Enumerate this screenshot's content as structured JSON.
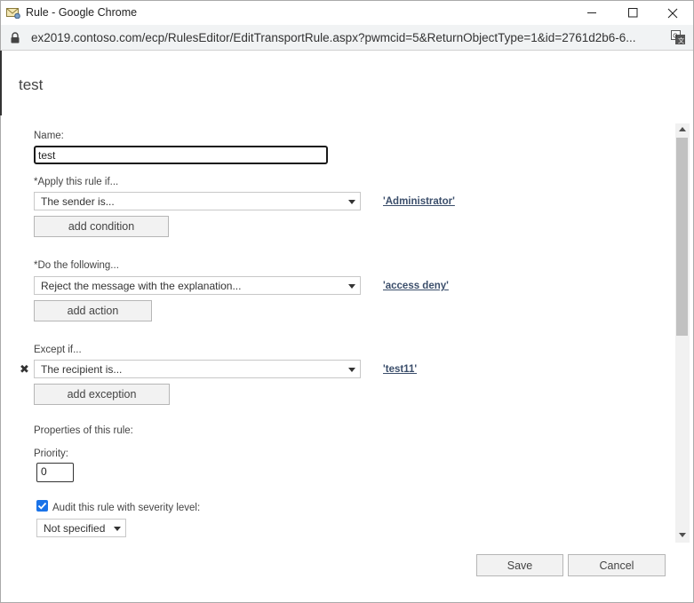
{
  "window": {
    "title": "Rule - Google Chrome",
    "url": "ex2019.contoso.com/ecp/RulesEditor/EditTransportRule.aspx?pwmcid=5&ReturnObjectType=1&id=2761d2b6-6..."
  },
  "page": {
    "title": "test"
  },
  "form": {
    "name_label": "Name:",
    "name_value": "test",
    "apply_label": "*Apply this rule if...",
    "apply_condition": "The sender is...",
    "apply_value_link": "'Administrator'",
    "add_condition_label": "add condition",
    "do_label": "*Do the following...",
    "do_action": "Reject the message with the explanation...",
    "do_value_link": "'access deny'",
    "add_action_label": "add action",
    "except_label": "Except if...",
    "remove_icon_glyph": "✖",
    "except_condition": "The recipient is...",
    "except_value_link": "'test11'",
    "add_exception_label": "add exception",
    "properties_label": "Properties of this rule:",
    "priority_label": "Priority:",
    "priority_value": "0",
    "audit_label": "Audit this rule with severity level:",
    "audit_checked": true,
    "severity_value": "Not specified"
  },
  "footer": {
    "save_label": "Save",
    "cancel_label": "Cancel"
  },
  "colors": {
    "link": "#3b4e6b",
    "checkbox_accent": "#1a73e8"
  }
}
